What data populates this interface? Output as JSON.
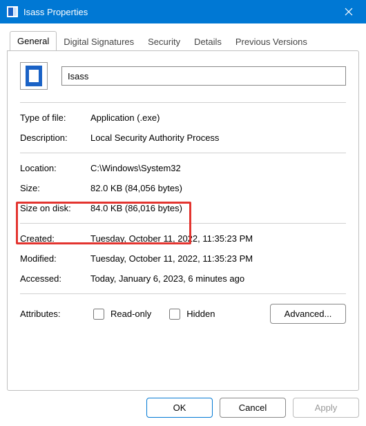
{
  "title": "Isass Properties",
  "tabs": {
    "general": "General",
    "sigs": "Digital Signatures",
    "security": "Security",
    "details": "Details",
    "prev": "Previous Versions"
  },
  "filename": "Isass",
  "fields": {
    "type_label": "Type of file:",
    "type_value": "Application (.exe)",
    "desc_label": "Description:",
    "desc_value": "Local Security Authority Process",
    "loc_label": "Location:",
    "loc_value": "C:\\Windows\\System32",
    "size_label": "Size:",
    "size_value": "82.0 KB (84,056 bytes)",
    "sizeondisk_label": "Size on disk:",
    "sizeondisk_value": "84.0 KB (86,016 bytes)",
    "created_label": "Created:",
    "created_value": "Tuesday, October 11, 2022, 11:35:23 PM",
    "modified_label": "Modified:",
    "modified_value": "Tuesday, October 11, 2022, 11:35:23 PM",
    "accessed_label": "Accessed:",
    "accessed_value": "Today, January 6, 2023, 6 minutes ago",
    "attributes_label": "Attributes:",
    "readonly_label": "Read-only",
    "hidden_label": "Hidden",
    "advanced_label": "Advanced..."
  },
  "buttons": {
    "ok": "OK",
    "cancel": "Cancel",
    "apply": "Apply"
  }
}
